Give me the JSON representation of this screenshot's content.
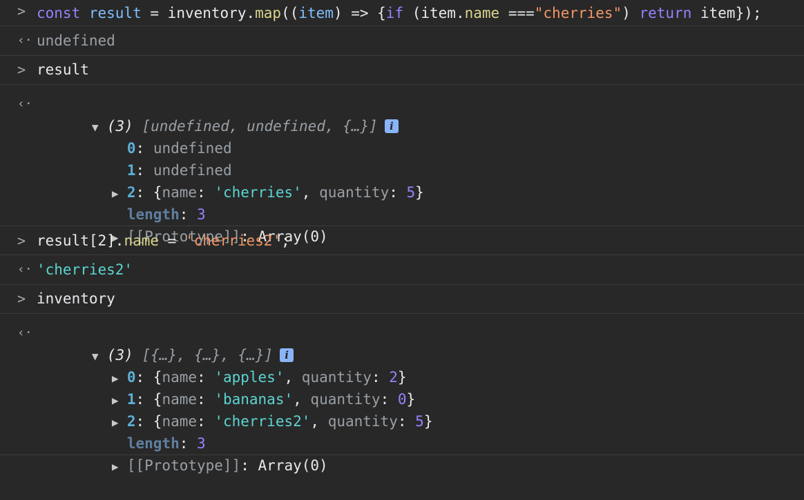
{
  "entries": [
    {
      "type": "input",
      "tokens": {
        "const": "const",
        "result": "result",
        "eq": " = ",
        "inventory": "inventory",
        "dot": ".",
        "map": "map",
        "open": "((",
        "item": "item",
        "arrow": ") => {",
        "if": "if",
        "paren": " (item.",
        "name": "name",
        "teq": " ===",
        "str": "\"cherries\"",
        "close": ") ",
        "return": "return",
        "tail": " item});"
      }
    },
    {
      "type": "output",
      "text": "undefined"
    },
    {
      "type": "input",
      "text": "result"
    },
    {
      "type": "output-array",
      "summary": {
        "count": "(3)",
        "items": "[undefined, undefined, {…}]"
      },
      "rows": [
        {
          "key": "0",
          "value": "undefined"
        },
        {
          "key": "1",
          "value": "undefined"
        },
        {
          "key": "2",
          "name_label": "name",
          "name_value": "'cherries'",
          "qty_label": "quantity",
          "qty_value": "5"
        }
      ],
      "length_label": "length",
      "length_value": "3",
      "prototype_label": "[[Prototype]]",
      "prototype_value": "Array(0)"
    },
    {
      "type": "input",
      "tokens": {
        "result": "result",
        "idx": "[2]",
        "name": "name",
        "eq": " = ",
        "str": "'cherries2'",
        "semi": ";"
      }
    },
    {
      "type": "output",
      "text": "'cherries2'"
    },
    {
      "type": "input",
      "text": "inventory"
    },
    {
      "type": "output-array",
      "summary": {
        "count": "(3)",
        "items": "[{…}, {…}, {…}]"
      },
      "rows": [
        {
          "key": "0",
          "name_label": "name",
          "name_value": "'apples'",
          "qty_label": "quantity",
          "qty_value": "2"
        },
        {
          "key": "1",
          "name_label": "name",
          "name_value": "'bananas'",
          "qty_label": "quantity",
          "qty_value": "0"
        },
        {
          "key": "2",
          "name_label": "name",
          "name_value": "'cherries2'",
          "qty_label": "quantity",
          "qty_value": "5"
        }
      ],
      "length_label": "length",
      "length_value": "3",
      "prototype_label": "[[Prototype]]",
      "prototype_value": "Array(0)"
    }
  ],
  "icons": {
    "input_prompt": "chevron-right-icon",
    "output_prompt": "return-arrow-icon",
    "expand": "triangle-right-icon",
    "collapse": "triangle-down-icon",
    "info": "info-icon"
  },
  "colors": {
    "background": "#282828",
    "divider": "#3d3d3d",
    "keyword": "#9980ff",
    "string_input": "#f29766",
    "string_output": "#5cd5d1",
    "number": "#9980ff",
    "function": "#dbd58c",
    "key": "#5db0d7",
    "info_badge": "#8ab4f8"
  }
}
